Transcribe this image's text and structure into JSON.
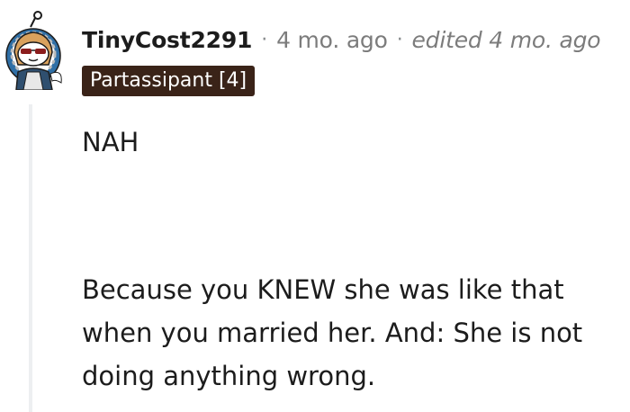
{
  "comment": {
    "author": "TinyCost2291",
    "separator": "·",
    "posted": "4 mo. ago",
    "edited": "edited 4 mo. ago",
    "flair": "Partassipant [4]",
    "paragraphs": [
      "NAH",
      "Because you KNEW she was like that when you married her. And: She is not doing anything wrong."
    ]
  },
  "colors": {
    "flair_bg": "#3a2318",
    "meta_gray": "#7c7c7c",
    "thread_line": "#edeff1",
    "avatar_blue": "#2f6fa6",
    "avatar_hair": "#d9a15d"
  },
  "icons": {
    "avatar": "snoo-avatar-icon"
  }
}
